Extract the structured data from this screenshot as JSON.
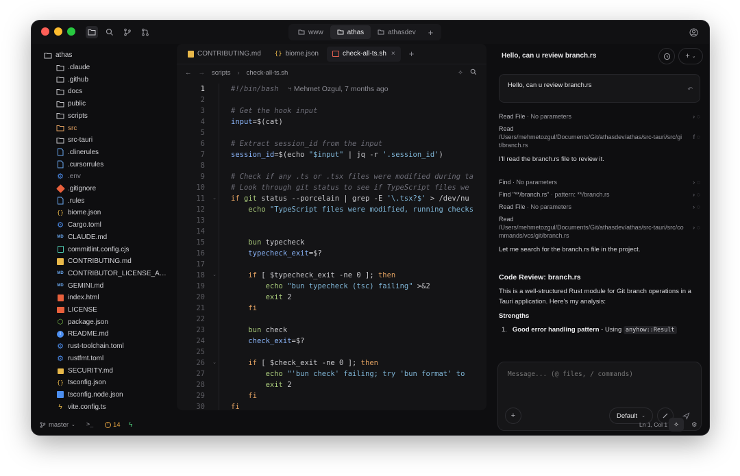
{
  "window": {
    "top_tabs": [
      {
        "label": "www"
      },
      {
        "label": "athas"
      },
      {
        "label": "athasdev"
      }
    ]
  },
  "sidebar": {
    "root": "athas",
    "items": [
      {
        "label": ".claude",
        "icon": "folder-icon",
        "color": "#d0d0d4"
      },
      {
        "label": ".github",
        "icon": "folder-icon",
        "color": "#d0d0d4"
      },
      {
        "label": "docs",
        "icon": "folder-icon",
        "color": "#d0d0d4"
      },
      {
        "label": "public",
        "icon": "folder-icon",
        "color": "#d0d0d4"
      },
      {
        "label": "scripts",
        "icon": "folder-icon",
        "color": "#d0d0d4"
      },
      {
        "label": "src",
        "icon": "folder-icon",
        "color": "#e0a060"
      },
      {
        "label": "src-tauri",
        "icon": "folder-icon",
        "color": "#d0d0d4"
      },
      {
        "label": ".clinerules",
        "icon": "file-icon",
        "color": "#d0d0d4"
      },
      {
        "label": ".cursorrules",
        "icon": "file-icon",
        "color": "#d0d0d4"
      },
      {
        "label": ".env",
        "icon": "gear-icon",
        "color": "#8a8a92"
      },
      {
        "label": ".gitignore",
        "icon": "git-icon",
        "color": "#d0d0d4"
      },
      {
        "label": ".rules",
        "icon": "file-icon",
        "color": "#d0d0d4"
      },
      {
        "label": "biome.json",
        "icon": "json-icon",
        "color": "#d0d0d4"
      },
      {
        "label": "Cargo.toml",
        "icon": "gear-icon",
        "color": "#d0d0d4"
      },
      {
        "label": "CLAUDE.md",
        "icon": "markdown-icon",
        "color": "#d0d0d4"
      },
      {
        "label": "commitlint.config.cjs",
        "icon": "js-icon",
        "color": "#d0d0d4"
      },
      {
        "label": "CONTRIBUTING.md",
        "icon": "markdown-yellow-icon",
        "color": "#d0d0d4"
      },
      {
        "label": "CONTRIBUTOR_LICENSE_AND_FE",
        "icon": "markdown-icon",
        "color": "#d0d0d4"
      },
      {
        "label": "GEMINI.md",
        "icon": "markdown-icon",
        "color": "#d0d0d4"
      },
      {
        "label": "index.html",
        "icon": "html-icon",
        "color": "#d0d0d4"
      },
      {
        "label": "LICENSE",
        "icon": "license-icon",
        "color": "#d0d0d4"
      },
      {
        "label": "package.json",
        "icon": "node-icon",
        "color": "#d0d0d4"
      },
      {
        "label": "README.md",
        "icon": "info-icon",
        "color": "#d0d0d4"
      },
      {
        "label": "rust-toolchain.toml",
        "icon": "gear-icon",
        "color": "#d0d0d4"
      },
      {
        "label": "rustfmt.toml",
        "icon": "gear-icon",
        "color": "#d0d0d4"
      },
      {
        "label": "SECURITY.md",
        "icon": "lock-icon",
        "color": "#d0d0d4"
      },
      {
        "label": "tsconfig.json",
        "icon": "json-icon",
        "color": "#d0d0d4"
      },
      {
        "label": "tsconfig.node.json",
        "icon": "ts-icon",
        "color": "#d0d0d4"
      },
      {
        "label": "vite.config.ts",
        "icon": "vite-icon",
        "color": "#d0d0d4"
      }
    ]
  },
  "editor": {
    "tabs": [
      {
        "label": "CONTRIBUTING.md"
      },
      {
        "label": "biome.json"
      },
      {
        "label": "check-all-ts.sh"
      }
    ],
    "breadcrumb": [
      "scripts",
      "check-all-ts.sh"
    ],
    "blame": "Mehmet Ozgul, 7 months ago",
    "lines": [
      "1",
      "2",
      "3",
      "4",
      "5",
      "6",
      "7",
      "8",
      "9",
      "10",
      "11",
      "12",
      "13",
      "14",
      "15",
      "16",
      "17",
      "18",
      "19",
      "20",
      "21",
      "22",
      "23",
      "24",
      "25",
      "26",
      "27",
      "28",
      "29",
      "30"
    ],
    "code": [
      "#!/bin/bash",
      "",
      "# Get the hook input",
      "input=$(cat)",
      "",
      "# Extract session_id from the input",
      "session_id=$(echo \"$input\" | jq -r '.session_id')",
      "",
      "# Check if any .ts or .tsx files were modified during ta",
      "# Look through git status to see if TypeScript files we",
      "if git status --porcelain | grep -E '\\.tsx?$' > /dev/nu",
      "    echo \"TypeScript files were modified, running checks",
      "",
      "",
      "    bun typecheck",
      "    typecheck_exit=$?",
      "",
      "    if [ $typecheck_exit -ne 0 ]; then",
      "        echo \"bun typecheck (tsc) failing\" >&2",
      "        exit 2",
      "    fi",
      "",
      "    bun check",
      "    check_exit=$?",
      "",
      "    if [ $check_exit -ne 0 ]; then",
      "        echo \"'bun check' failing; try 'bun format' to ",
      "        exit 2",
      "    fi",
      "fi"
    ]
  },
  "chat": {
    "title": "Hello, can u review branch.rs",
    "user_message": "Hello, can u review branch.rs",
    "tool1_name": "Read File",
    "tool1_params": "No parameters",
    "tool2_name": "Read",
    "tool2_path": "/Users/mehmetozgul/Documents/Git/athasdev/athas/src-tauri/src/git/branch.rs",
    "msg1": "I'll read the branch.rs file to review it.",
    "tool3_name": "Find",
    "tool3_params": "No parameters",
    "tool4_name": "Find",
    "tool4_query": "\"**/branch.rs\"",
    "tool4_pattern": "pattern: **/branch.rs",
    "tool5_name": "Read File",
    "tool5_params": "No parameters",
    "tool6_name": "Read",
    "tool6_path": "/Users/mehmetozgul/Documents/Git/athasdev/athas/src-tauri/src/commands/vcs/git/branch.rs",
    "msg2": "Let me search for the branch.rs file in the project.",
    "review_heading": "Code Review: branch.rs",
    "review_intro": "This is a well-structured Rust module for Git branch operations in a Tauri application. Here's my analysis:",
    "strengths_heading": "Strengths",
    "strength1_num": "1.",
    "strength1_bold": "Good error handling pattern",
    "strength1_text": " - Using ",
    "strength1_code": "anyhow::Result",
    "input_placeholder": "Message... (@ files, / commands)",
    "mode_label": "Default"
  },
  "status": {
    "branch": "master",
    "terminal": ">_",
    "problems": "14",
    "position": "Ln 1, Col 1"
  },
  "colors": {
    "traffic_red": "#ff5f57",
    "traffic_yellow": "#febc2e",
    "traffic_green": "#28c840",
    "accent_orange": "#e0a060",
    "accent_green": "#4ec97a"
  }
}
